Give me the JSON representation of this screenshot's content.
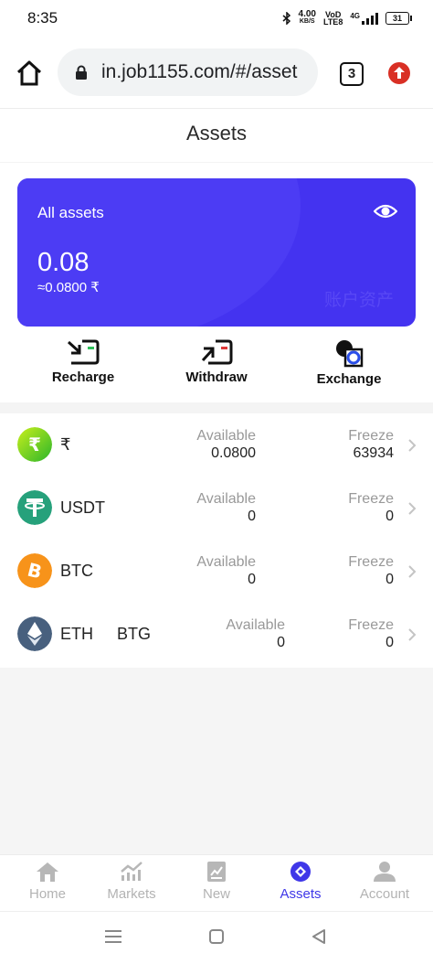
{
  "status_bar": {
    "time": "8:35",
    "net_speed": "4.00",
    "net_unit": "KB/S",
    "vo_top": "VoD",
    "vo_bottom": "LTE8",
    "net_type": "4G",
    "battery": "31"
  },
  "browser": {
    "url": "in.job1155.com/#/asset",
    "tab_count": "3"
  },
  "page": {
    "title": "Assets"
  },
  "card": {
    "label": "All assets",
    "value": "0.08",
    "approx": "≈0.0800 ₹",
    "watermark": "账户资产"
  },
  "actions": [
    {
      "label": "Recharge",
      "icon": "recharge-icon"
    },
    {
      "label": "Withdraw",
      "icon": "withdraw-icon"
    },
    {
      "label": "Exchange",
      "icon": "exchange-icon"
    }
  ],
  "columns": {
    "available": "Available",
    "freeze": "Freeze"
  },
  "coins": [
    {
      "name": "₹",
      "name2": "",
      "available": "0.0800",
      "freeze": "63934",
      "icon": "rupee-coin-icon",
      "color": "#45c41d"
    },
    {
      "name": "USDT",
      "name2": "",
      "available": "0",
      "freeze": "0",
      "icon": "tether-coin-icon",
      "color": "#26a17b"
    },
    {
      "name": "BTC",
      "name2": "",
      "available": "0",
      "freeze": "0",
      "icon": "bitcoin-coin-icon",
      "color": "#f7931a"
    },
    {
      "name": "ETH",
      "name2": "BTG",
      "available": "0",
      "freeze": "0",
      "icon": "ethereum-coin-icon",
      "color": "#48607e"
    }
  ],
  "tabbar": [
    {
      "label": "Home",
      "icon": "home-icon",
      "active": false
    },
    {
      "label": "Markets",
      "icon": "markets-icon",
      "active": false
    },
    {
      "label": "New",
      "icon": "new-icon",
      "active": false
    },
    {
      "label": "Assets",
      "icon": "assets-icon",
      "active": true
    },
    {
      "label": "Account",
      "icon": "account-icon",
      "active": false
    }
  ],
  "colors": {
    "accent": "#4433f0",
    "active_tab": "#3f37e8",
    "inactive_tab": "#b3b3b3"
  }
}
